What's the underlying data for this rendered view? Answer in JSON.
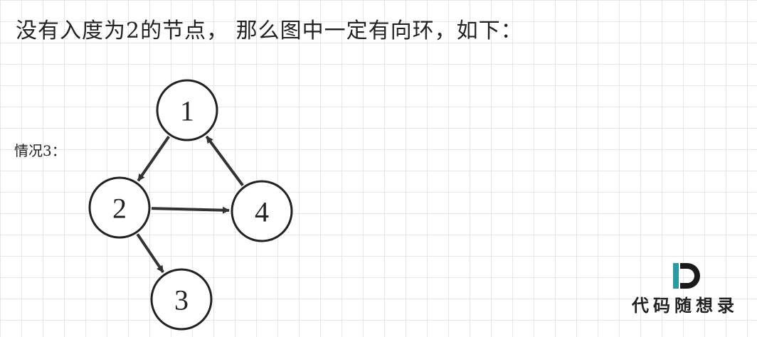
{
  "title": "没有入度为2的节点， 那么图中一定有向环，如下：",
  "case_label": "情况3：",
  "graph": {
    "nodes": [
      {
        "id": "1",
        "label": "1"
      },
      {
        "id": "2",
        "label": "2"
      },
      {
        "id": "3",
        "label": "3"
      },
      {
        "id": "4",
        "label": "4"
      }
    ],
    "edges": [
      {
        "from": "1",
        "to": "2"
      },
      {
        "from": "2",
        "to": "4"
      },
      {
        "from": "4",
        "to": "1"
      },
      {
        "from": "2",
        "to": "3"
      }
    ]
  },
  "watermark": {
    "text": "代码随想录",
    "logo_letter": "D",
    "colors": {
      "dark": "#1a1a1a",
      "accent": "#2c9aa0"
    }
  },
  "colors": {
    "grid": "#e6e6e6",
    "stroke": "#222222"
  }
}
